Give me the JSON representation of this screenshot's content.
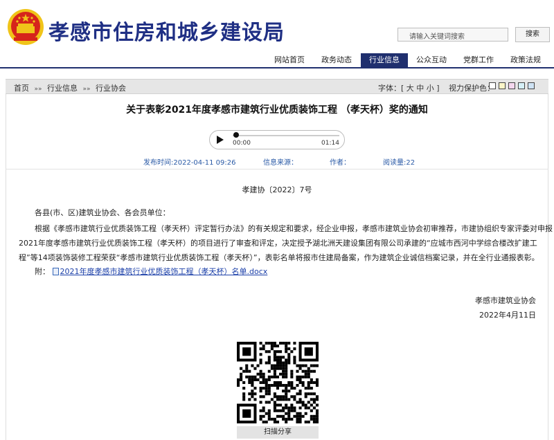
{
  "header": {
    "site_title": "孝感市住房和城乡建设局",
    "search_placeholder": "请输入关键词搜索",
    "search_button": "搜索"
  },
  "nav": {
    "items": [
      {
        "label": "网站首页"
      },
      {
        "label": "政务动态"
      },
      {
        "label": "行业信息",
        "active": true
      },
      {
        "label": "公众互动"
      },
      {
        "label": "党群工作"
      },
      {
        "label": "政策法规"
      }
    ]
  },
  "breadcrumb": {
    "items": [
      "首页",
      "行业信息",
      "行业协会"
    ],
    "separator": "»»"
  },
  "tools": {
    "font_label": "字体：",
    "font_open": "[",
    "font_large": "大",
    "font_medium": "中",
    "font_small": "小",
    "font_close": "]",
    "vision_label": "视力保护色：",
    "vision_colors": [
      "#ffffff",
      "#fbf5c8",
      "#f4d7ee",
      "#d6f0f7",
      "#cfe3f4"
    ]
  },
  "article": {
    "title": "关于表彰2021年度孝感市建筑行业优质装饰工程 （孝天杯）奖的通知",
    "audio": {
      "current_time": "00:00",
      "duration": "01:14",
      "progress": 0
    },
    "meta": {
      "publish_time": "发布时间:2022-04-11 09:26",
      "source": "信息来源：",
      "author": "作者：",
      "views": "阅读量:22"
    },
    "doc_number": "孝建协〔2022〕7号",
    "salutation": "各县(市、区)建筑业协会、各会员单位：",
    "body_lines": [
      "根据《孝感市建筑行业优质装饰工程（孝天杯）评定暂行办法》的有关规定和要求，经企业申报，孝感市建筑业协会初审推荐，市建协组织专家评委对申报",
      "2021年度孝感市建筑行业优质装饰工程（孝天杯）的项目进行了审查和评定，决定授予湖北洲天建设集团有限公司承建的“应城市西河中学综合楼改扩建工",
      "程”等14项装饰装修工程荣获“孝感市建筑行业优质装饰工程（孝天杯）”，表彰名单将报市住建局备案，作为建筑企业诚信档案记录，并在全行业通报表彰。"
    ],
    "attachment_label": "附：",
    "attachment_name": "2021年度孝感市建筑行业优质装饰工程（孝天杯）名单.docx",
    "signature_org": "孝感市建筑业协会",
    "signature_date": "2022年4月11日",
    "qr_label": "扫描分享"
  },
  "colors": {
    "brand_blue": "#1f2f84",
    "nav_active": "#1f2f6e",
    "emblem_red": "#d6241b",
    "emblem_gold": "#f0c419"
  }
}
